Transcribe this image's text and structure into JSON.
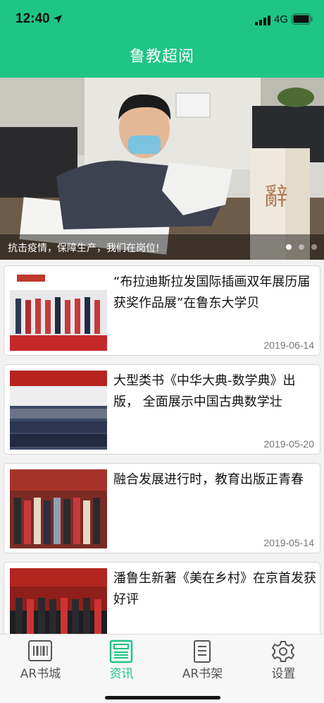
{
  "status_bar": {
    "time": "12:40",
    "network": "4G"
  },
  "header": {
    "title": "鲁教超阅"
  },
  "banner": {
    "caption": "抗击疫情，保障生产，我们在岗位!",
    "page_count": 3,
    "active_index": 0
  },
  "news": [
    {
      "title": "“布拉迪斯拉发国际插画双年展历届获奖作品展”在鲁东大学贝",
      "date": "2019-06-14"
    },
    {
      "title": "大型类书《中华大典-数学典》出版， 全面展示中国古典数学壮",
      "date": "2019-05-20"
    },
    {
      "title": "融合发展进行时，教育出版正青春",
      "date": "2019-05-14"
    },
    {
      "title": "潘鲁生新著《美在乡村》在京首发获好评",
      "date": ""
    }
  ],
  "tabbar": {
    "active": "news",
    "items": [
      {
        "key": "ar-books",
        "label": "AR书城",
        "icon": "barcode-store-icon"
      },
      {
        "key": "news",
        "label": "资讯",
        "icon": "news-icon"
      },
      {
        "key": "ar-shelf",
        "label": "AR书架",
        "icon": "bookshelf-icon"
      },
      {
        "key": "settings",
        "label": "设置",
        "icon": "gear-icon"
      }
    ]
  },
  "colors": {
    "brand": "#1ec586",
    "tab_inactive": "#555555"
  }
}
